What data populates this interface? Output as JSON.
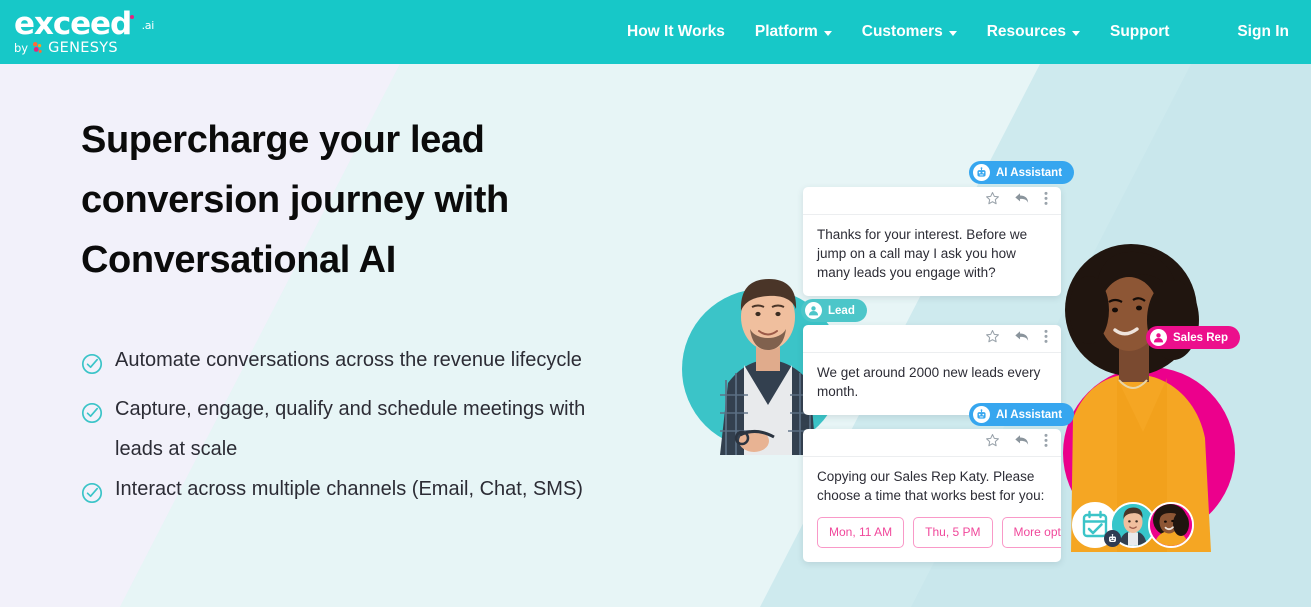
{
  "header": {
    "logo": {
      "main": "exceed",
      "superscript": ".ai",
      "by": "by",
      "brand": "GENESYS"
    },
    "nav": [
      {
        "label": "How It Works",
        "has_caret": false,
        "icon": ""
      },
      {
        "label": "Platform",
        "has_caret": true,
        "icon": "chevron-down-icon"
      },
      {
        "label": "Customers",
        "has_caret": true,
        "icon": "chevron-down-icon"
      },
      {
        "label": "Resources",
        "has_caret": true,
        "icon": "chevron-down-icon"
      },
      {
        "label": "Support",
        "has_caret": false,
        "icon": ""
      }
    ],
    "sign_in": "Sign In",
    "bg_color": "#17c8c8"
  },
  "hero": {
    "headline_line1": "Supercharge your lead",
    "headline_line2": "conversion journey with",
    "headline_line3": "Conversational AI",
    "bullets": [
      {
        "icon": "circle-check-icon",
        "text": "Automate conversations across the revenue lifecycle"
      },
      {
        "icon": "circle-check-icon",
        "text": "Capture, engage, qualify and schedule meetings with leads at scale"
      },
      {
        "icon": "circle-check-icon",
        "text": "Interact across multiple channels (Email, Chat, SMS)"
      }
    ]
  },
  "conversation": {
    "messages": [
      {
        "badge": {
          "label": "AI Assistant",
          "color": "#36a6ef",
          "icon": "robot-avatar-icon"
        },
        "actions": [
          "star-icon",
          "reply-icon",
          "more-vertical-icon"
        ],
        "text": "Thanks for your interest. Before we jump on a call may I ask you how many leads you engage with?",
        "slots": []
      },
      {
        "badge": {
          "label": "Lead",
          "color": "#4cc6c9",
          "icon": "person-avatar-icon"
        },
        "actions": [
          "star-icon",
          "reply-icon",
          "more-vertical-icon"
        ],
        "text": "We get around 2000 new leads every month.",
        "slots": []
      },
      {
        "badge": {
          "label": "AI Assistant",
          "color": "#36a6ef",
          "icon": "robot-avatar-icon"
        },
        "actions": [
          "star-icon",
          "reply-icon",
          "more-vertical-icon"
        ],
        "text": "Copying our Sales Rep Katy. Please choose a time that works best for you:",
        "slots": [
          "Mon, 11 AM",
          "Thu, 5 PM",
          "More options"
        ]
      }
    ],
    "sales_rep_badge": {
      "label": "Sales Rep",
      "color": "#ec0f8c",
      "icon": "person-avatar-icon"
    }
  },
  "avatar_cluster": {
    "items": [
      {
        "name": "calendar-check-icon",
        "type": "icon"
      },
      {
        "name": "avatar-male",
        "type": "photo"
      },
      {
        "name": "avatar-female",
        "type": "photo"
      }
    ],
    "robot_badge_icon": "robot-badge-icon"
  },
  "colors": {
    "brand_teal": "#17c8c8",
    "accent_pink": "#ec008c",
    "accent_blue": "#36a6ef",
    "check_teal": "#3bc4c8",
    "page_bg": "#f2f1fa"
  }
}
